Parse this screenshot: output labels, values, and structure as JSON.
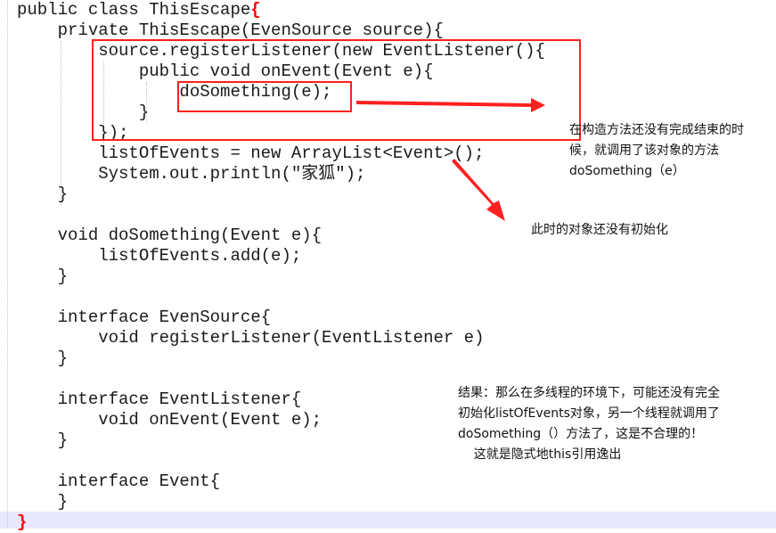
{
  "code": {
    "lines": [
      "public class ThisEscape",
      "    private ThisEscape(EvenSource source){",
      "        source.registerListener(new EventListener(){",
      "            public void onEvent(Event e){",
      "                doSomething(e);",
      "            }",
      "        });",
      "        listOfEvents = new ArrayList<Event>();",
      "        System.out.println(\"家狐\");",
      "    }",
      "",
      "    void doSomething(Event e){",
      "        listOfEvents.add(e);",
      "    }",
      "",
      "    interface EvenSource{",
      "        void registerListener(EventListener e)",
      "    }",
      "",
      "    interface EventListener{",
      "        void onEvent(Event e);",
      "    }",
      "",
      "    interface Event{",
      "    }",
      ""
    ],
    "open_brace": "{",
    "close_brace": "}"
  },
  "annotations": {
    "note1": [
      "在构造方法还没有完成结束的时",
      "候，就调用了该对象的方法",
      "doSomething（e）"
    ],
    "note2": [
      "此时的对象还没有初始化"
    ],
    "note3": [
      "结果：那么在多线程的环境下，可能还没有完全",
      "初始化listOfEvents对象，另一个线程就调用了",
      "doSomething（）方法了，这是不合理的！",
      "    这就是隐式地this引用逸出"
    ]
  },
  "colors": {
    "highlight_red": "#ff2020",
    "last_line_bg": "#e8e8ff",
    "code_text": "#1a1a1a"
  }
}
